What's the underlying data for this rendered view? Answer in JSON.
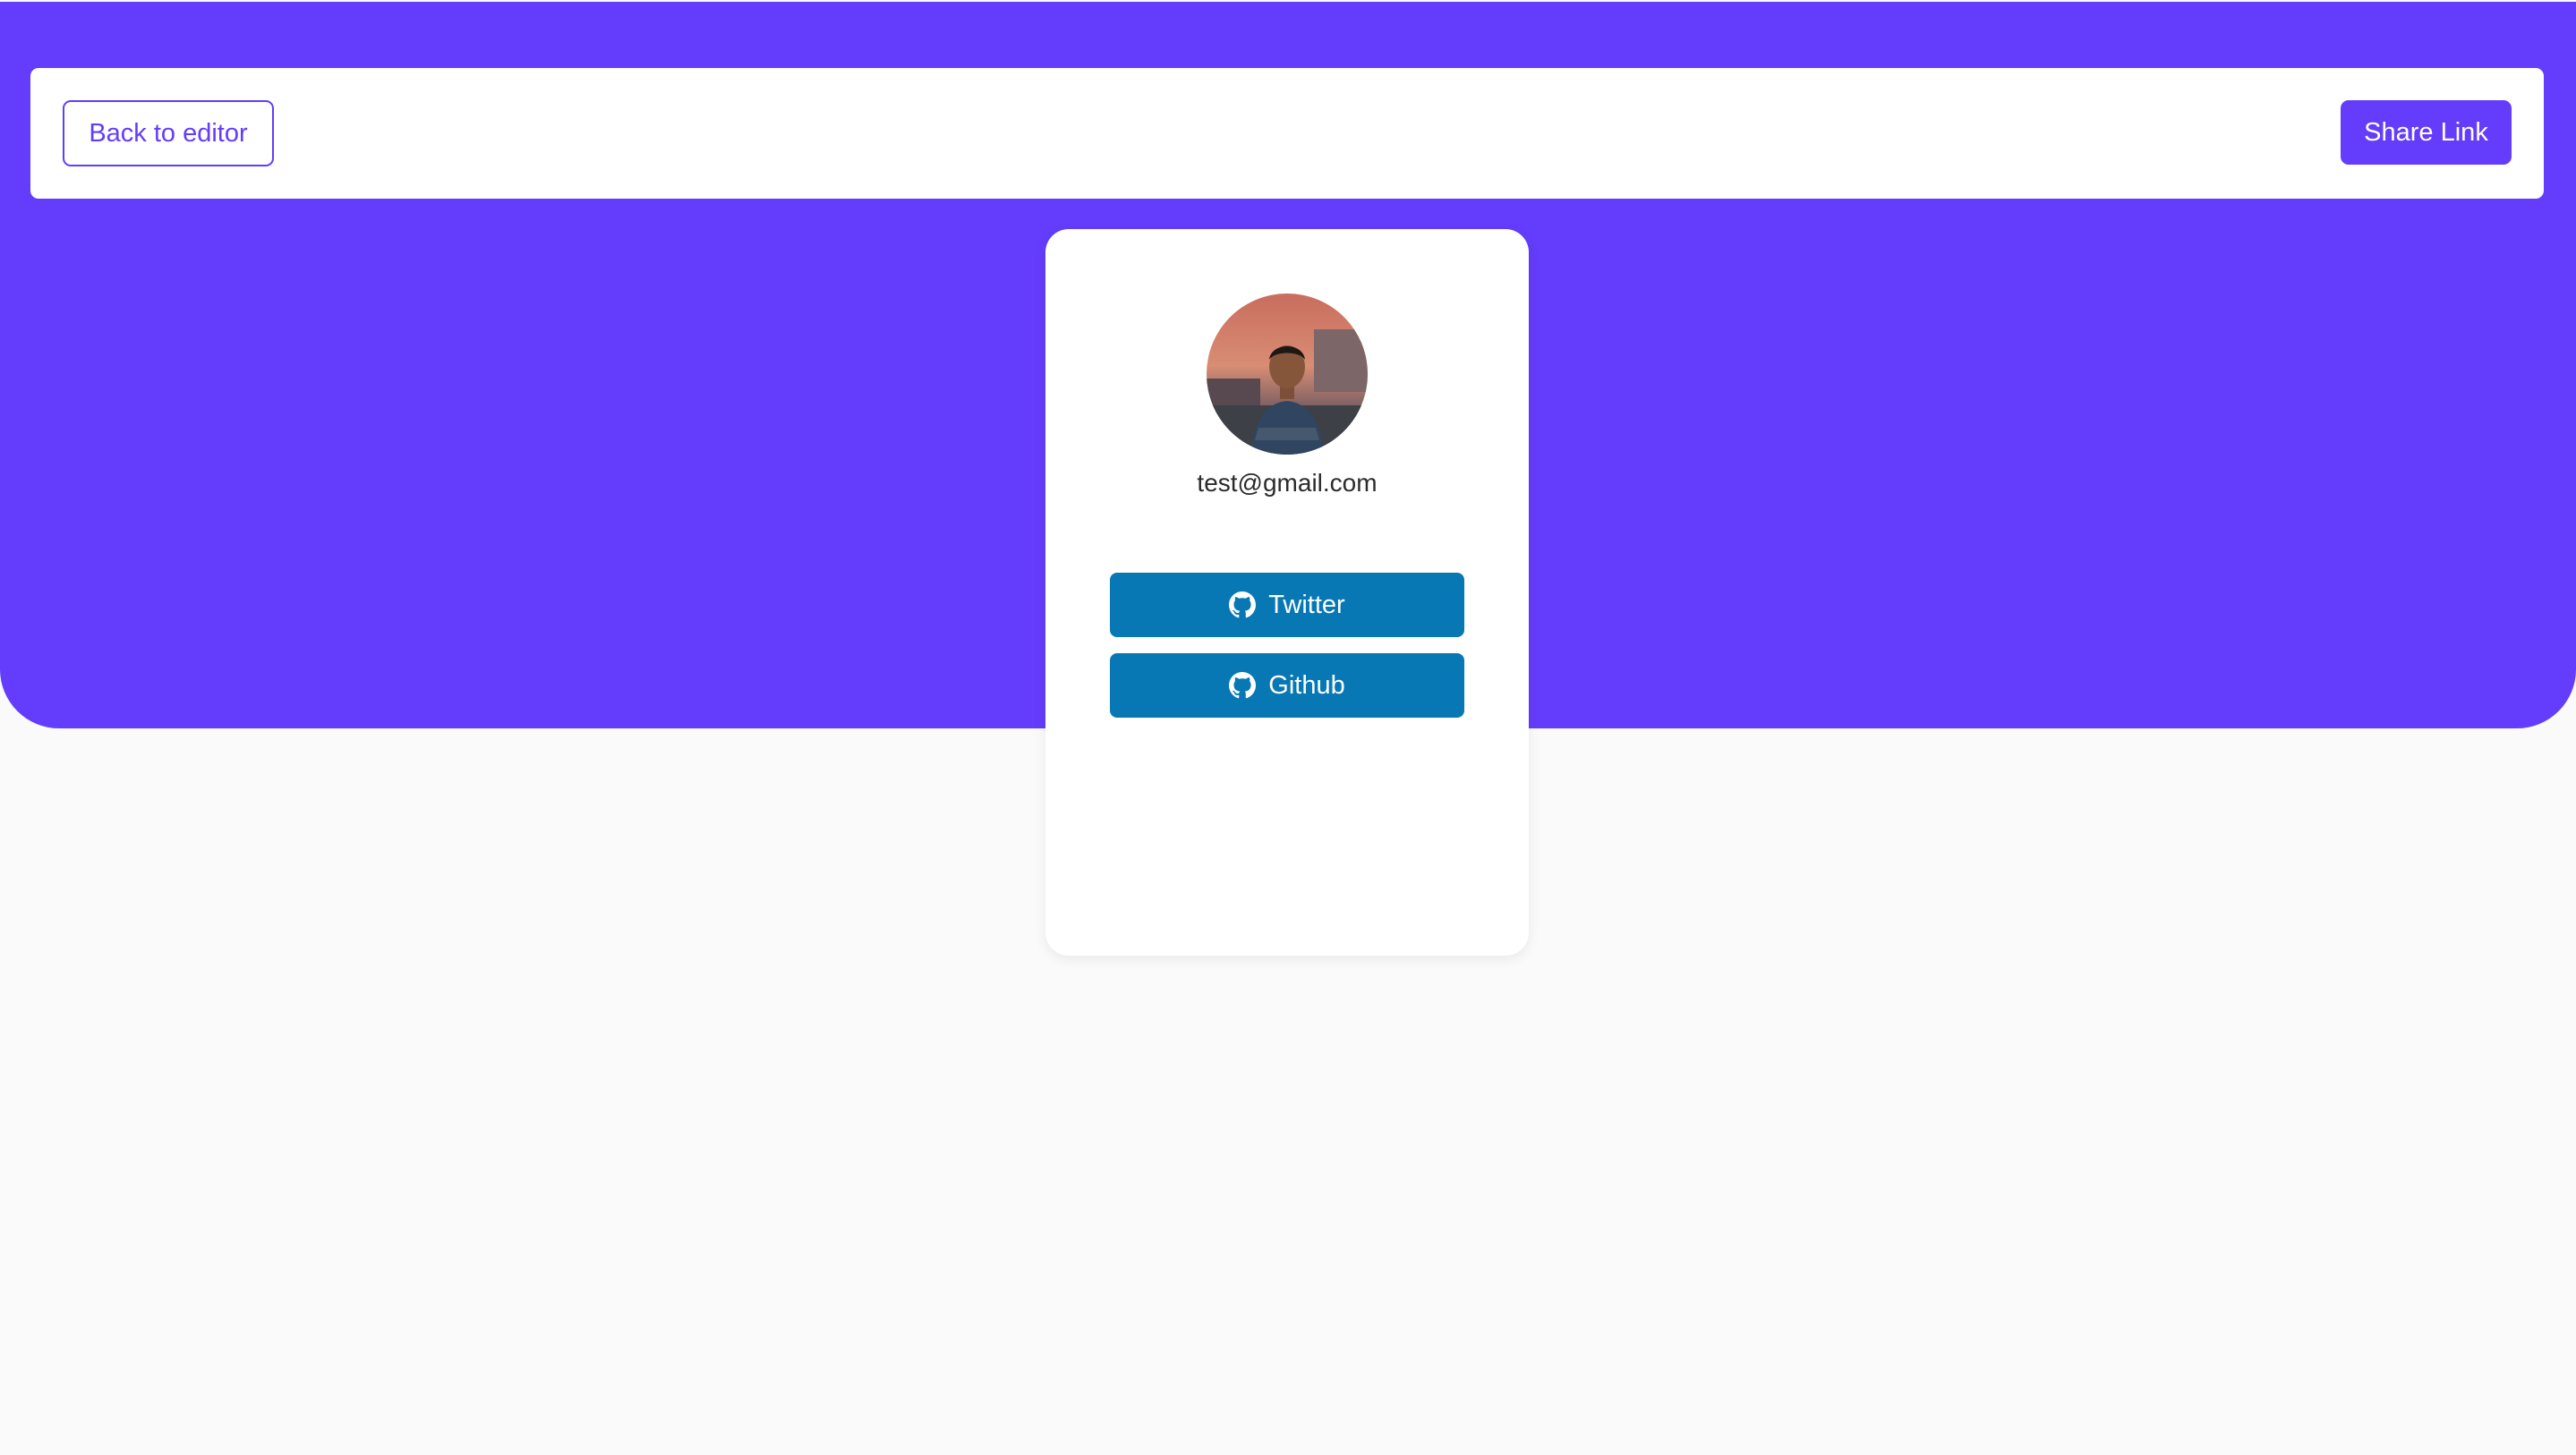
{
  "header": {
    "back_label": "Back to editor",
    "share_label": "Share Link"
  },
  "profile": {
    "email": "test@gmail.com",
    "avatar_icon": "profile-photo",
    "links": [
      {
        "label": "Twitter",
        "icon": "github-icon"
      },
      {
        "label": "Github",
        "icon": "github-icon"
      }
    ]
  },
  "colors": {
    "accent": "#643cfb",
    "link_button": "#0778b4",
    "page_background": "#fafafa",
    "card_background": "#ffffff"
  }
}
